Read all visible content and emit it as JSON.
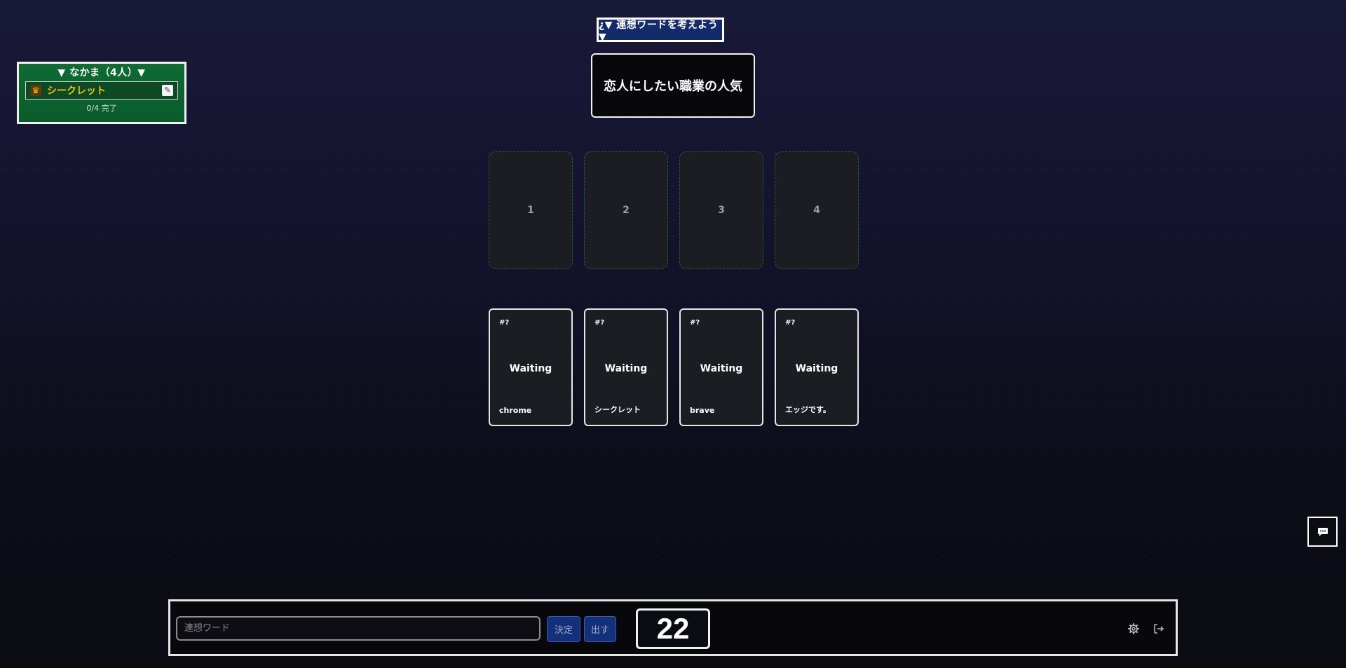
{
  "banner": {
    "text": "¿▼ 連想ワードを考えよう ▼"
  },
  "topic": {
    "text": "恋人にしたい職業の人気"
  },
  "players": {
    "title": "▼ なかま（4人）▼",
    "list": [
      {
        "name": "シークレット",
        "crown_icon": "crown-icon",
        "memo_icon": "memo-icon"
      }
    ],
    "progress": "0/4 完了"
  },
  "slots": [
    "1",
    "2",
    "3",
    "4"
  ],
  "hand_cards": [
    {
      "number": "#?",
      "status": "Waiting",
      "label": "chrome"
    },
    {
      "number": "#?",
      "status": "Waiting",
      "label": "シークレット"
    },
    {
      "number": "#?",
      "status": "Waiting",
      "label": "brave"
    },
    {
      "number": "#?",
      "status": "Waiting",
      "label": "エッジです。"
    }
  ],
  "input": {
    "placeholder": "連想ワード",
    "value": ""
  },
  "buttons": {
    "decide": "決定",
    "submit": "出す"
  },
  "timer": {
    "value": "22"
  },
  "icons": {
    "settings": "gear-icon",
    "exit": "logout-icon",
    "chat": "chat-icon"
  },
  "colors": {
    "banner_bg": "#132b6b",
    "players_bg": "#0f6b34",
    "player_name": "#f3c420",
    "button_bg": "#14307a"
  }
}
